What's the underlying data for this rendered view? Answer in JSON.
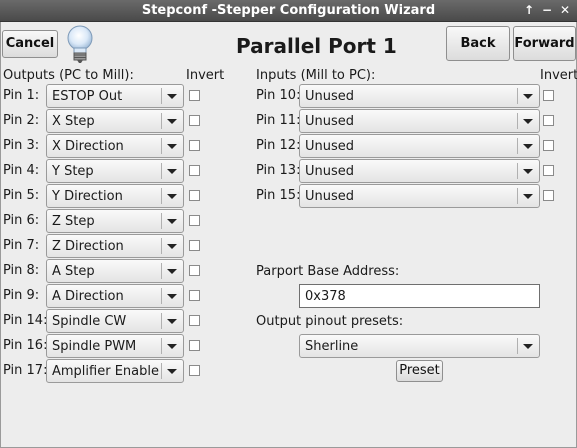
{
  "window": {
    "title": "Stepconf -Stepper Configuration Wizard"
  },
  "header": {
    "cancel_label": "Cancel",
    "page_title": "Parallel Port 1",
    "back_label": "Back",
    "forward_label": "Forward",
    "icon": "lightbulb-icon"
  },
  "outputs": {
    "heading": "Outputs (PC to Mill):",
    "invert_heading": "Invert",
    "pins": [
      {
        "pin": "Pin 1:",
        "value": "ESTOP Out"
      },
      {
        "pin": "Pin 2:",
        "value": "X Step"
      },
      {
        "pin": "Pin 3:",
        "value": "X Direction"
      },
      {
        "pin": "Pin 4:",
        "value": "Y Step"
      },
      {
        "pin": "Pin 5:",
        "value": "Y Direction"
      },
      {
        "pin": "Pin 6:",
        "value": "Z Step"
      },
      {
        "pin": "Pin 7:",
        "value": "Z Direction"
      },
      {
        "pin": "Pin 8:",
        "value": "A Step"
      },
      {
        "pin": "Pin 9:",
        "value": "A Direction"
      },
      {
        "pin": "Pin 14:",
        "value": "Spindle CW"
      },
      {
        "pin": "Pin 16:",
        "value": "Spindle PWM"
      },
      {
        "pin": "Pin 17:",
        "value": "Amplifier Enable"
      }
    ]
  },
  "inputs": {
    "heading": "Inputs (Mill to PC):",
    "invert_heading": "Invert",
    "pins": [
      {
        "pin": "Pin 10:",
        "value": "Unused"
      },
      {
        "pin": "Pin 11:",
        "value": "Unused"
      },
      {
        "pin": "Pin 12:",
        "value": "Unused"
      },
      {
        "pin": "Pin 13:",
        "value": "Unused"
      },
      {
        "pin": "Pin 15:",
        "value": "Unused"
      }
    ]
  },
  "parport": {
    "base_label": "Parport Base Address:",
    "base_value": "0x378",
    "presets_label": "Output pinout presets:",
    "presets_value": "Sherline",
    "preset_button": "Preset"
  }
}
